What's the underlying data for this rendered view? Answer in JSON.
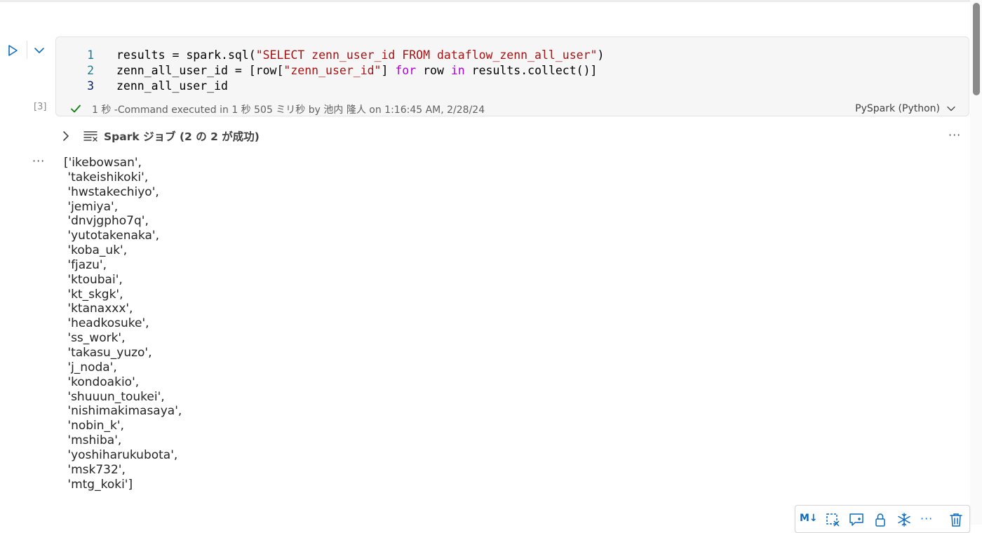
{
  "cell": {
    "execution_count": "[3]",
    "code_lines": [
      {
        "num": "1",
        "parts": [
          {
            "text": "results = spark.sql(",
            "type": "plain"
          },
          {
            "text": "\"SELECT zenn_user_id FROM dataflow_zenn_all_user\"",
            "type": "str"
          },
          {
            "text": ")",
            "type": "plain"
          }
        ]
      },
      {
        "num": "2",
        "parts": [
          {
            "text": "zenn_all_user_id = [row[",
            "type": "plain"
          },
          {
            "text": "\"zenn_user_id\"",
            "type": "str"
          },
          {
            "text": "] ",
            "type": "plain"
          },
          {
            "text": "for",
            "type": "kw"
          },
          {
            "text": " row ",
            "type": "plain"
          },
          {
            "text": "in",
            "type": "kw"
          },
          {
            "text": " results.collect()]",
            "type": "plain"
          }
        ]
      },
      {
        "num": "3",
        "parts": [
          {
            "text": "zenn_all_user_id",
            "type": "plain"
          }
        ]
      }
    ],
    "status_text": "1 秒 -Command executed in 1 秒 505 ミリ秒 by 池内 隆人 on 1:16:45 AM, 2/28/24",
    "language": "PySpark (Python)"
  },
  "spark_jobs": {
    "title": "Spark ジョブ (2 の 2 が成功)",
    "more_label": "···"
  },
  "output": {
    "more_label": "···",
    "lines": [
      "['ikebowsan',",
      " 'takeishikoki',",
      " 'hwstakechiyo',",
      " 'jemiya',",
      " 'dnvjgpho7q',",
      " 'yutotakenaka',",
      " 'koba_uk',",
      " 'fjazu',",
      " 'ktoubai',",
      " 'kt_skgk',",
      " 'ktanaxxx',",
      " 'headkosuke',",
      " 'ss_work',",
      " 'takasu_yuzo',",
      " 'j_noda',",
      " 'kondoakio',",
      " 'shuuun_toukei',",
      " 'nishimakimasaya',",
      " 'nobin_k',",
      " 'mshiba',",
      " 'yoshiharukubota',",
      " 'msk732',",
      " 'mtg_koki']"
    ]
  },
  "toolbar": {
    "markdown_label": "M↓",
    "more_label": "···"
  },
  "icons": {
    "run": "play-icon",
    "collapse": "chevron-down-icon",
    "success": "checkmark-icon",
    "expand": "chevron-right-icon",
    "jobs": "list-icon"
  },
  "colors": {
    "run": "#0f6cbd",
    "success": "#107c10",
    "line_number": "#237893",
    "string": "#a31515",
    "keyword": "#af00db"
  }
}
